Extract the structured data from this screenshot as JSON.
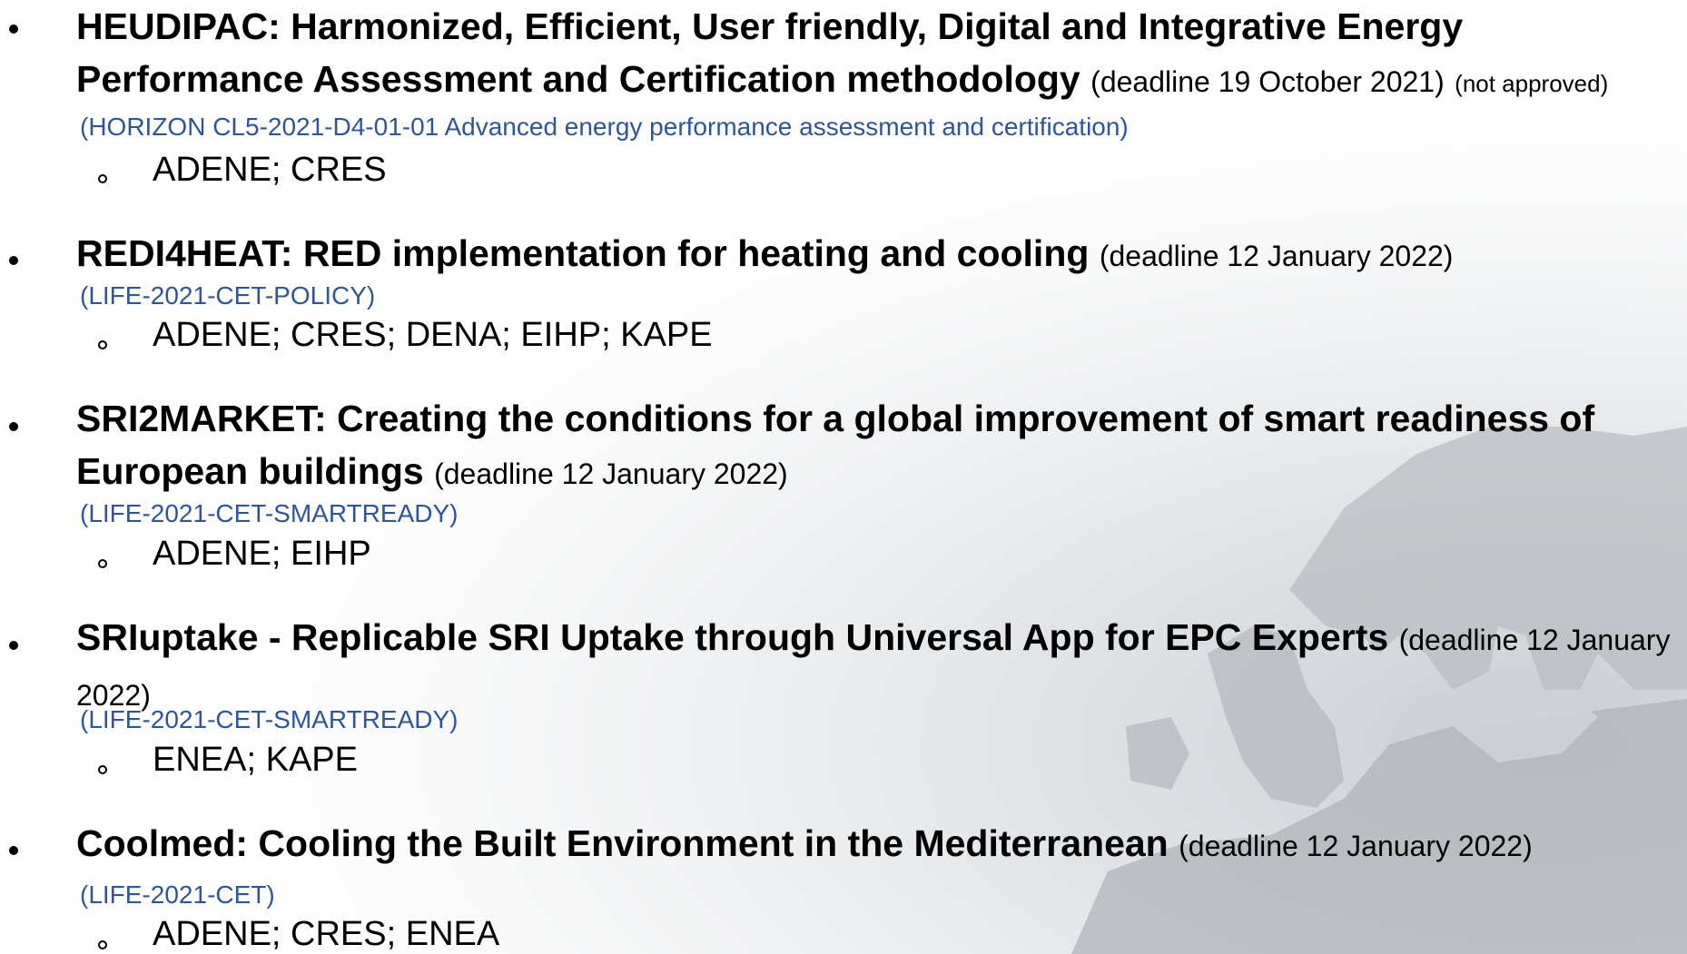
{
  "projects": [
    {
      "title": "HEUDIPAC: Harmonized, Efficient, User friendly, Digital and Integrative Energy Performance Assessment and Certification methodology",
      "deadline": "(deadline 19 October 2021)",
      "status": "(not approved)",
      "call": "(HORIZON CL5-2021-D4-01-01 Advanced energy performance assessment and certification)",
      "partners": "ADENE; CRES"
    },
    {
      "title": "REDI4HEAT: RED implementation for heating and cooling",
      "deadline": "(deadline 12 January 2022)",
      "call": "(LIFE-2021-CET-POLICY)",
      "partners": "ADENE; CRES; DENA; EIHP; KAPE"
    },
    {
      "title": "SRI2MARKET: Creating the conditions for a global improvement of smart readiness of European buildings",
      "deadline": "(deadline 12 January 2022)",
      "call": "(LIFE-2021-CET-SMARTREADY)",
      "partners": "ADENE; EIHP"
    },
    {
      "title": "SRIuptake - Replicable SRI Uptake through Universal App for EPC Experts",
      "deadline": "(deadline 12 January 2022)",
      "call": "(LIFE-2021-CET-SMARTREADY)",
      "partners": "ENEA; KAPE"
    },
    {
      "title": "Coolmed: Cooling the Built Environment in the Mediterranean",
      "deadline": "(deadline 12 January 2022)",
      "call": "(LIFE-2021-CET)",
      "partners": "ADENE; CRES; ENEA"
    }
  ]
}
